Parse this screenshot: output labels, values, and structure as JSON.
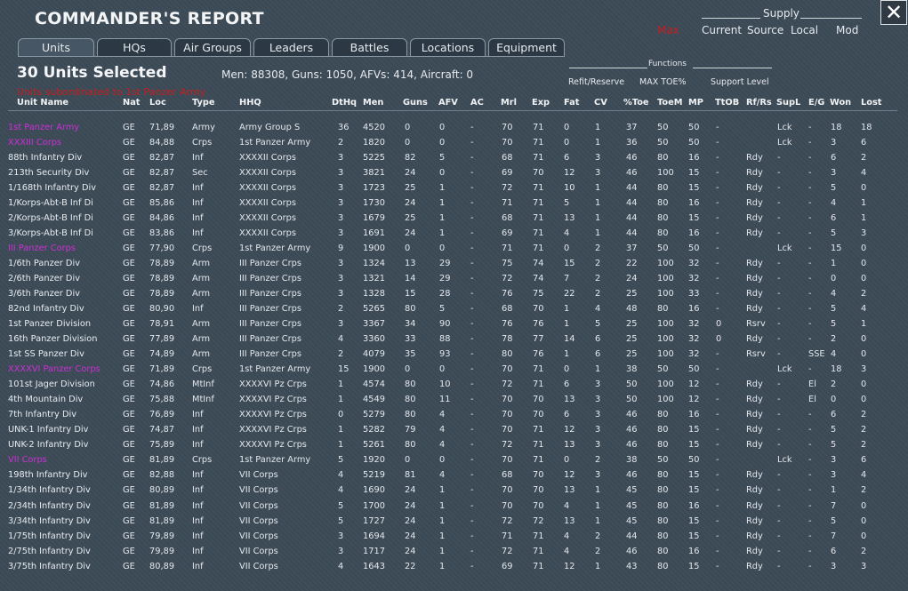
{
  "window": {
    "title": "COMMANDER'S REPORT",
    "close_label": "✕"
  },
  "supply": {
    "header": "Supply",
    "options": [
      {
        "label": "Max",
        "active": true
      },
      {
        "label": "Current",
        "active": false
      },
      {
        "label": "Source",
        "active": false
      },
      {
        "label": "Local",
        "active": false
      },
      {
        "label": "Mod",
        "active": false
      }
    ]
  },
  "tabs": [
    {
      "label": "Units",
      "active": true
    },
    {
      "label": "HQs",
      "active": false
    },
    {
      "label": "Air Groups",
      "active": false
    },
    {
      "label": "Leaders",
      "active": false
    },
    {
      "label": "Battles",
      "active": false
    },
    {
      "label": "Locations",
      "active": false
    },
    {
      "label": "Equipment",
      "active": false
    }
  ],
  "summary": {
    "selected": "30 Units Selected",
    "stats": "Men: 88308, Guns: 1050, AFVs: 414, Aircraft: 0",
    "subordinate": "Units subordinated to 1st Panzer Army"
  },
  "functions": {
    "header": "Functions",
    "options": [
      "Refit/Reserve",
      "MAX TOE%",
      "Support Level"
    ]
  },
  "table": {
    "columns": [
      "Unit Name",
      "Nat",
      "Loc",
      "Type",
      "HHQ",
      "DtHq",
      "Men",
      "Guns",
      "AFV",
      "AC",
      "Mrl",
      "Exp",
      "Fat",
      "CV",
      "%Toe",
      "ToeM",
      "MP",
      "TtOB",
      "Rf/Rs",
      "SupL",
      "E/G",
      "Won",
      "Lost"
    ],
    "rows": [
      {
        "hq": true,
        "cells": [
          "1st Panzer Army",
          "GE",
          "71,89",
          "Army",
          "Army Group S",
          "36",
          "4520",
          "0",
          "0",
          "-",
          "70",
          "71",
          "0",
          "1",
          "37",
          "50",
          "50",
          "-",
          "",
          "Lck",
          "-",
          "18",
          "18"
        ]
      },
      {
        "hq": true,
        "cells": [
          "XXXIII Corps",
          "GE",
          "84,88",
          "Crps",
          "1st Panzer Army",
          "2",
          "1820",
          "0",
          "0",
          "-",
          "70",
          "71",
          "0",
          "1",
          "36",
          "50",
          "50",
          "-",
          "",
          "Lck",
          "-",
          "3",
          "6"
        ]
      },
      {
        "hq": false,
        "cells": [
          "88th Infantry Div",
          "GE",
          "82,87",
          "Inf",
          "XXXXII Corps",
          "3",
          "5225",
          "82",
          "5",
          "-",
          "68",
          "71",
          "6",
          "3",
          "46",
          "80",
          "16",
          "-",
          "Rdy",
          "-",
          "-",
          "6",
          "2"
        ]
      },
      {
        "hq": false,
        "cells": [
          "213th Security Div",
          "GE",
          "82,87",
          "Sec",
          "XXXXII Corps",
          "3",
          "3821",
          "24",
          "0",
          "-",
          "69",
          "70",
          "12",
          "3",
          "46",
          "100",
          "15",
          "-",
          "Rdy",
          "-",
          "-",
          "3",
          "4"
        ]
      },
      {
        "hq": false,
        "cells": [
          "1/168th Infantry Div",
          "GE",
          "82,87",
          "Inf",
          "XXXXII Corps",
          "3",
          "1723",
          "25",
          "1",
          "-",
          "72",
          "71",
          "10",
          "1",
          "44",
          "80",
          "15",
          "-",
          "Rdy",
          "-",
          "-",
          "5",
          "0"
        ]
      },
      {
        "hq": false,
        "cells": [
          "1/Korps-Abt-B Inf Di",
          "GE",
          "85,86",
          "Inf",
          "XXXXII Corps",
          "3",
          "1730",
          "24",
          "1",
          "-",
          "71",
          "71",
          "5",
          "1",
          "44",
          "80",
          "16",
          "-",
          "Rdy",
          "-",
          "-",
          "4",
          "1"
        ]
      },
      {
        "hq": false,
        "cells": [
          "2/Korps-Abt-B Inf Di",
          "GE",
          "84,86",
          "Inf",
          "XXXXII Corps",
          "3",
          "1679",
          "25",
          "1",
          "-",
          "68",
          "71",
          "13",
          "1",
          "44",
          "80",
          "15",
          "-",
          "Rdy",
          "-",
          "-",
          "6",
          "1"
        ]
      },
      {
        "hq": false,
        "cells": [
          "3/Korps-Abt-B Inf Di",
          "GE",
          "83,86",
          "Inf",
          "XXXXII Corps",
          "3",
          "1691",
          "24",
          "1",
          "-",
          "69",
          "71",
          "4",
          "1",
          "44",
          "80",
          "16",
          "-",
          "Rdy",
          "-",
          "-",
          "5",
          "3"
        ]
      },
      {
        "hq": true,
        "cells": [
          "III Panzer Corps",
          "GE",
          "77,90",
          "Crps",
          "1st Panzer Army",
          "9",
          "1900",
          "0",
          "0",
          "-",
          "71",
          "71",
          "0",
          "2",
          "37",
          "50",
          "50",
          "-",
          "",
          "Lck",
          "-",
          "15",
          "0"
        ]
      },
      {
        "hq": false,
        "cells": [
          "1/6th Panzer Div",
          "GE",
          "78,89",
          "Arm",
          "III Panzer Crps",
          "3",
          "1324",
          "13",
          "29",
          "-",
          "75",
          "74",
          "15",
          "2",
          "22",
          "100",
          "32",
          "-",
          "Rdy",
          "-",
          "-",
          "1",
          "0"
        ]
      },
      {
        "hq": false,
        "cells": [
          "2/6th Panzer Div",
          "GE",
          "78,89",
          "Arm",
          "III Panzer Crps",
          "3",
          "1321",
          "14",
          "29",
          "-",
          "72",
          "74",
          "7",
          "2",
          "24",
          "100",
          "32",
          "-",
          "Rdy",
          "-",
          "-",
          "0",
          "0"
        ]
      },
      {
        "hq": false,
        "cells": [
          "3/6th Panzer Div",
          "GE",
          "78,89",
          "Arm",
          "III Panzer Crps",
          "3",
          "1328",
          "15",
          "28",
          "-",
          "76",
          "75",
          "22",
          "2",
          "25",
          "100",
          "33",
          "-",
          "Rdy",
          "-",
          "-",
          "4",
          "2"
        ]
      },
      {
        "hq": false,
        "cells": [
          "82nd Infantry Div",
          "GE",
          "80,90",
          "Inf",
          "III Panzer Crps",
          "2",
          "5265",
          "80",
          "5",
          "-",
          "68",
          "70",
          "1",
          "4",
          "48",
          "80",
          "16",
          "-",
          "Rdy",
          "-",
          "-",
          "5",
          "4"
        ]
      },
      {
        "hq": false,
        "cells": [
          "1st Panzer Division",
          "GE",
          "78,91",
          "Arm",
          "III Panzer Crps",
          "3",
          "3367",
          "34",
          "90",
          "-",
          "76",
          "76",
          "1",
          "5",
          "25",
          "100",
          "32",
          "0",
          "Rsrv",
          "-",
          "-",
          "5",
          "1"
        ]
      },
      {
        "hq": false,
        "cells": [
          "16th Panzer Division",
          "GE",
          "77,89",
          "Arm",
          "III Panzer Crps",
          "4",
          "3360",
          "33",
          "88",
          "-",
          "78",
          "77",
          "14",
          "6",
          "25",
          "100",
          "32",
          "0",
          "Rdy",
          "-",
          "-",
          "2",
          "0"
        ]
      },
      {
        "hq": false,
        "cells": [
          "1st SS Panzer Div",
          "GE",
          "74,89",
          "Arm",
          "III Panzer Crps",
          "2",
          "4079",
          "35",
          "93",
          "-",
          "80",
          "76",
          "1",
          "6",
          "25",
          "100",
          "32",
          "-",
          "Rsrv",
          "-",
          "SSE",
          "4",
          "0"
        ]
      },
      {
        "hq": true,
        "cells": [
          "XXXXVI Panzer Corps",
          "GE",
          "71,89",
          "Crps",
          "1st Panzer Army",
          "15",
          "1900",
          "0",
          "0",
          "-",
          "70",
          "71",
          "0",
          "1",
          "38",
          "50",
          "50",
          "-",
          "",
          "Lck",
          "-",
          "18",
          "3"
        ]
      },
      {
        "hq": false,
        "cells": [
          "101st Jager Division",
          "GE",
          "74,86",
          "MtInf",
          "XXXXVI Pz Crps",
          "1",
          "4574",
          "80",
          "10",
          "-",
          "72",
          "71",
          "6",
          "3",
          "50",
          "100",
          "12",
          "-",
          "Rdy",
          "-",
          "El",
          "2",
          "0"
        ]
      },
      {
        "hq": false,
        "cells": [
          "4th Mountain Div",
          "GE",
          "75,88",
          "MtInf",
          "XXXXVI Pz Crps",
          "1",
          "4549",
          "80",
          "11",
          "-",
          "70",
          "70",
          "13",
          "3",
          "50",
          "100",
          "12",
          "-",
          "Rdy",
          "-",
          "El",
          "0",
          "0"
        ]
      },
      {
        "hq": false,
        "cells": [
          "7th Infantry Div",
          "GE",
          "76,89",
          "Inf",
          "XXXXVI Pz Crps",
          "0",
          "5279",
          "80",
          "4",
          "-",
          "70",
          "70",
          "6",
          "3",
          "46",
          "80",
          "16",
          "-",
          "Rdy",
          "-",
          "-",
          "6",
          "2"
        ]
      },
      {
        "hq": false,
        "cells": [
          "UNK-1 Infantry Div",
          "GE",
          "74,87",
          "Inf",
          "XXXXVI Pz Crps",
          "1",
          "5282",
          "79",
          "4",
          "-",
          "70",
          "71",
          "12",
          "3",
          "46",
          "80",
          "15",
          "-",
          "Rdy",
          "-",
          "-",
          "5",
          "2"
        ]
      },
      {
        "hq": false,
        "cells": [
          "UNK-2 Infantry Div",
          "GE",
          "75,89",
          "Inf",
          "XXXXVI Pz Crps",
          "1",
          "5261",
          "80",
          "4",
          "-",
          "72",
          "71",
          "13",
          "3",
          "46",
          "80",
          "15",
          "-",
          "Rdy",
          "-",
          "-",
          "5",
          "2"
        ]
      },
      {
        "hq": true,
        "cells": [
          "VII Corps",
          "GE",
          "81,89",
          "Crps",
          "1st Panzer Army",
          "5",
          "1920",
          "0",
          "0",
          "-",
          "70",
          "71",
          "0",
          "2",
          "38",
          "50",
          "50",
          "-",
          "",
          "Lck",
          "-",
          "3",
          "6"
        ]
      },
      {
        "hq": false,
        "cells": [
          "198th Infantry Div",
          "GE",
          "82,88",
          "Inf",
          "VII Corps",
          "4",
          "5219",
          "81",
          "4",
          "-",
          "68",
          "70",
          "12",
          "3",
          "46",
          "80",
          "15",
          "-",
          "Rdy",
          "-",
          "-",
          "3",
          "4"
        ]
      },
      {
        "hq": false,
        "cells": [
          "1/34th Infantry Div",
          "GE",
          "80,89",
          "Inf",
          "VII Corps",
          "4",
          "1690",
          "24",
          "1",
          "-",
          "70",
          "70",
          "13",
          "1",
          "45",
          "80",
          "15",
          "-",
          "Rdy",
          "-",
          "-",
          "1",
          "2"
        ]
      },
      {
        "hq": false,
        "cells": [
          "2/34th Infantry Div",
          "GE",
          "81,89",
          "Inf",
          "VII Corps",
          "5",
          "1700",
          "24",
          "1",
          "-",
          "70",
          "70",
          "4",
          "1",
          "45",
          "80",
          "16",
          "-",
          "Rdy",
          "-",
          "-",
          "7",
          "0"
        ]
      },
      {
        "hq": false,
        "cells": [
          "3/34th Infantry Div",
          "GE",
          "81,89",
          "Inf",
          "VII Corps",
          "5",
          "1727",
          "24",
          "1",
          "-",
          "72",
          "72",
          "13",
          "1",
          "45",
          "80",
          "15",
          "-",
          "Rdy",
          "-",
          "-",
          "5",
          "0"
        ]
      },
      {
        "hq": false,
        "cells": [
          "1/75th Infantry Div",
          "GE",
          "79,89",
          "Inf",
          "VII Corps",
          "3",
          "1694",
          "24",
          "1",
          "-",
          "71",
          "71",
          "4",
          "2",
          "44",
          "80",
          "15",
          "-",
          "Rdy",
          "-",
          "-",
          "7",
          "0"
        ]
      },
      {
        "hq": false,
        "cells": [
          "2/75th Infantry Div",
          "GE",
          "79,89",
          "Inf",
          "VII Corps",
          "3",
          "1717",
          "24",
          "1",
          "-",
          "72",
          "71",
          "4",
          "2",
          "46",
          "80",
          "16",
          "-",
          "Rdy",
          "-",
          "-",
          "6",
          "2"
        ]
      },
      {
        "hq": false,
        "cells": [
          "3/75th Infantry Div",
          "GE",
          "80,89",
          "Inf",
          "VII Corps",
          "4",
          "1643",
          "22",
          "1",
          "-",
          "69",
          "71",
          "12",
          "1",
          "43",
          "80",
          "15",
          "-",
          "Rdy",
          "-",
          "-",
          "3",
          "3"
        ]
      }
    ]
  }
}
